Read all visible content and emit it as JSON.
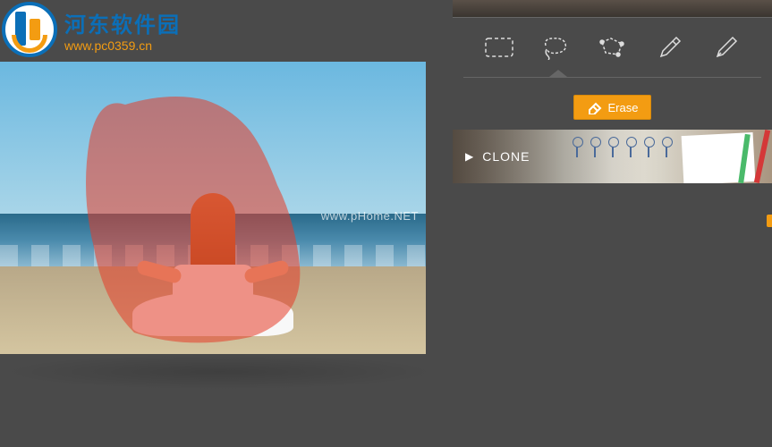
{
  "logo": {
    "title": "河东软件园",
    "url": "www.pc0359.cn"
  },
  "watermark": "www.pHome.NET",
  "tools": {
    "rect_select": "rectangle-select",
    "lasso": "lasso-select",
    "poly": "polygon-select",
    "brush": "brush-select",
    "pen": "pen-tool",
    "active": "lasso"
  },
  "actions": {
    "erase_label": "Erase"
  },
  "sections": {
    "clone_label": "CLONE"
  },
  "colors": {
    "accent": "#f39c12",
    "mask": "rgba(230,60,40,0.55)"
  }
}
